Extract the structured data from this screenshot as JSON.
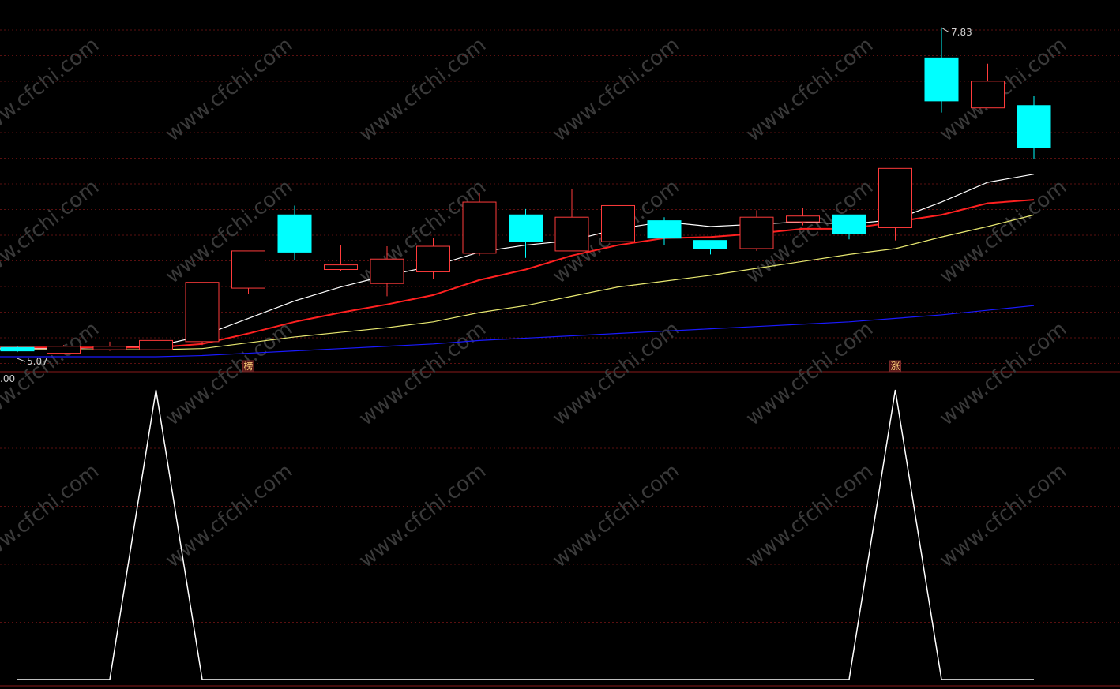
{
  "chart_data": [
    {
      "type": "candlestick",
      "title": "",
      "ylim": [
        5.0,
        8.0
      ],
      "grid": true,
      "candles": [
        {
          "open": 5.08,
          "close": 5.05,
          "high": 5.09,
          "low": 5.04
        },
        {
          "open": 5.03,
          "close": 5.09,
          "high": 5.1,
          "low": 5.02
        },
        {
          "open": 5.06,
          "close": 5.09,
          "high": 5.13,
          "low": 5.05
        },
        {
          "open": 5.06,
          "close": 5.14,
          "high": 5.19,
          "low": 5.04
        },
        {
          "open": 5.13,
          "close": 5.64,
          "high": 5.64,
          "low": 5.1
        },
        {
          "open": 5.59,
          "close": 5.91,
          "high": 5.91,
          "low": 5.54
        },
        {
          "open": 6.22,
          "close": 5.9,
          "high": 6.3,
          "low": 5.83
        },
        {
          "open": 5.75,
          "close": 5.79,
          "high": 5.96,
          "low": 5.74
        },
        {
          "open": 5.63,
          "close": 5.84,
          "high": 5.95,
          "low": 5.52
        },
        {
          "open": 5.73,
          "close": 5.95,
          "high": 6.02,
          "low": 5.67
        },
        {
          "open": 5.89,
          "close": 6.33,
          "high": 6.41,
          "low": 5.87
        },
        {
          "open": 6.22,
          "close": 5.99,
          "high": 6.27,
          "low": 5.85
        },
        {
          "open": 5.91,
          "close": 6.2,
          "high": 6.44,
          "low": 5.91
        },
        {
          "open": 5.99,
          "close": 6.3,
          "high": 6.4,
          "low": 5.99
        },
        {
          "open": 6.17,
          "close": 6.02,
          "high": 6.2,
          "low": 5.96
        },
        {
          "open": 6.0,
          "close": 5.93,
          "high": 6.0,
          "low": 5.88
        },
        {
          "open": 5.93,
          "close": 6.2,
          "high": 6.26,
          "low": 5.91
        },
        {
          "open": 6.16,
          "close": 6.21,
          "high": 6.28,
          "low": 6.13
        },
        {
          "open": 6.22,
          "close": 6.06,
          "high": 6.22,
          "low": 6.01
        },
        {
          "open": 6.11,
          "close": 6.62,
          "high": 6.62,
          "low": 6.0
        },
        {
          "open": 7.57,
          "close": 7.2,
          "high": 7.83,
          "low": 7.1
        },
        {
          "open": 7.14,
          "close": 7.37,
          "high": 7.52,
          "low": 7.14
        },
        {
          "open": 7.16,
          "close": 6.8,
          "high": 7.24,
          "low": 6.7
        }
      ],
      "series": [
        {
          "color": "#ffffff",
          "values": [
            5.07,
            5.07,
            5.08,
            5.09,
            5.18,
            5.33,
            5.48,
            5.6,
            5.7,
            5.78,
            5.9,
            5.96,
            6.0,
            6.1,
            6.16,
            6.12,
            6.14,
            6.16,
            6.14,
            6.18,
            6.33,
            6.5,
            6.57
          ]
        },
        {
          "color": "#ff2020",
          "values": [
            5.08,
            5.08,
            5.08,
            5.08,
            5.11,
            5.2,
            5.3,
            5.38,
            5.45,
            5.53,
            5.66,
            5.75,
            5.87,
            5.96,
            6.02,
            6.03,
            6.06,
            6.1,
            6.1,
            6.16,
            6.22,
            6.32,
            6.35
          ]
        },
        {
          "color": "#e8e870",
          "values": [
            5.06,
            5.06,
            5.06,
            5.06,
            5.07,
            5.12,
            5.17,
            5.21,
            5.25,
            5.3,
            5.38,
            5.44,
            5.52,
            5.6,
            5.65,
            5.7,
            5.76,
            5.82,
            5.88,
            5.93,
            6.03,
            6.12,
            6.22
          ]
        },
        {
          "color": "#1a1aff",
          "values": [
            5.0,
            5.0,
            5.0,
            5.0,
            5.01,
            5.03,
            5.05,
            5.07,
            5.09,
            5.11,
            5.14,
            5.16,
            5.18,
            5.2,
            5.22,
            5.24,
            5.26,
            5.28,
            5.3,
            5.33,
            5.36,
            5.4,
            5.44
          ]
        }
      ],
      "annotations": [
        {
          "candle": 20,
          "text": "7.83"
        },
        {
          "candle": 0,
          "text": "5.07"
        }
      ],
      "markers": [
        {
          "candle": 5,
          "text": "榜"
        },
        {
          "candle": 19,
          "text": "涨"
        }
      ]
    },
    {
      "type": "line",
      "title": "",
      "ylim": [
        0,
        1
      ],
      "tick_label": ".00",
      "series": [
        {
          "color": "#ffffff",
          "values": [
            0,
            0,
            0,
            1,
            0,
            0,
            0,
            0,
            0,
            0,
            0,
            0,
            0,
            0,
            0,
            0,
            0,
            0,
            0,
            1,
            0,
            0,
            0
          ]
        }
      ]
    }
  ],
  "watermark": "www.cfchi.com"
}
